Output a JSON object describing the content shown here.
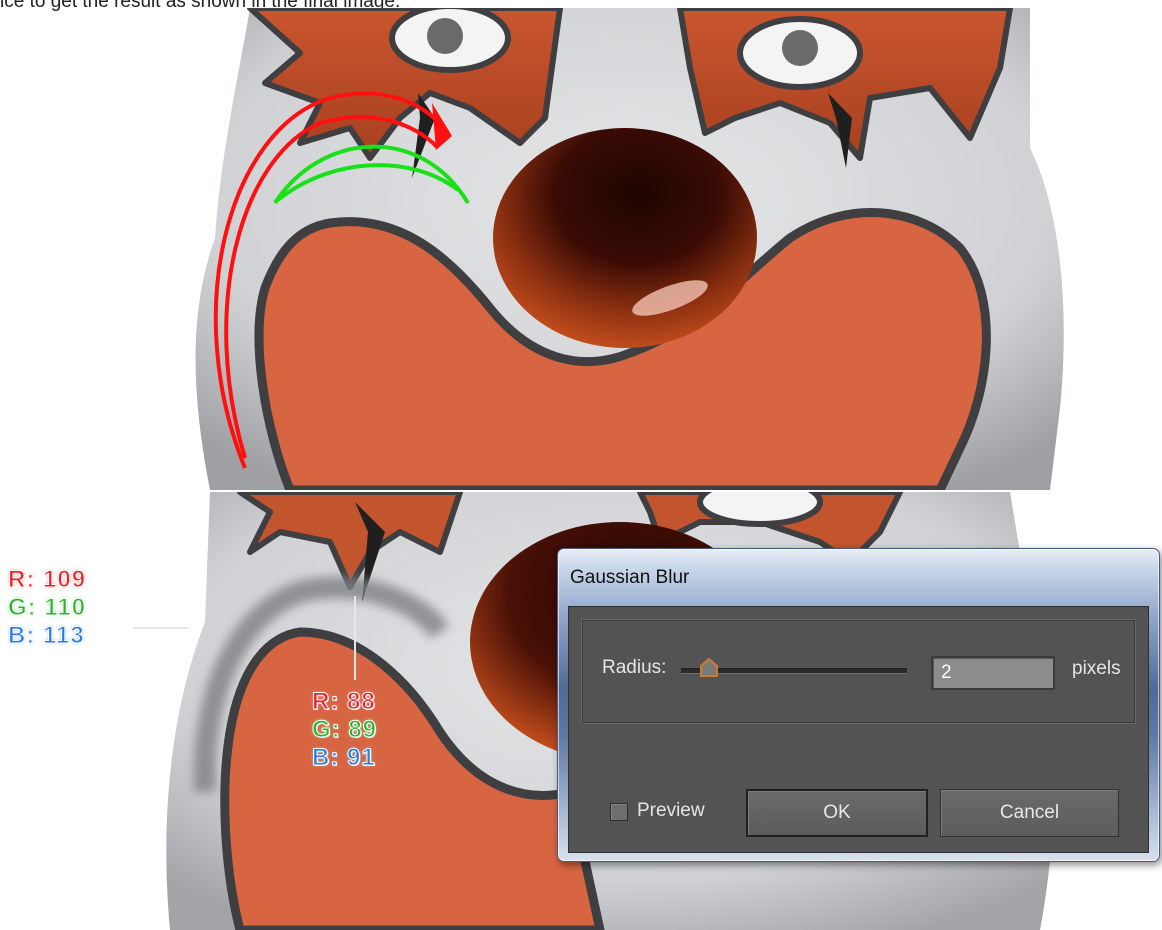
{
  "caption": "ice to get the result as shown in the final image.",
  "colors": {
    "skin": "#d86541",
    "face": "#d7d8da",
    "nose": "#9c3a14",
    "outline": "#3f3f41",
    "hair": "#c2542e",
    "red_arc": "#ff1010",
    "green_arc": "#19e119"
  },
  "labels": {
    "left": {
      "r": "R: 109",
      "g": "G: 110",
      "b": "B: 113"
    },
    "inner": {
      "r": "R: 88",
      "g": "G: 89",
      "b": "B: 91"
    }
  },
  "dialog": {
    "title": "Gaussian Blur",
    "radius_label": "Radius:",
    "radius_value": "2",
    "unit": "pixels",
    "preview_label": "Preview",
    "preview_checked": false,
    "ok_label": "OK",
    "cancel_label": "Cancel"
  }
}
